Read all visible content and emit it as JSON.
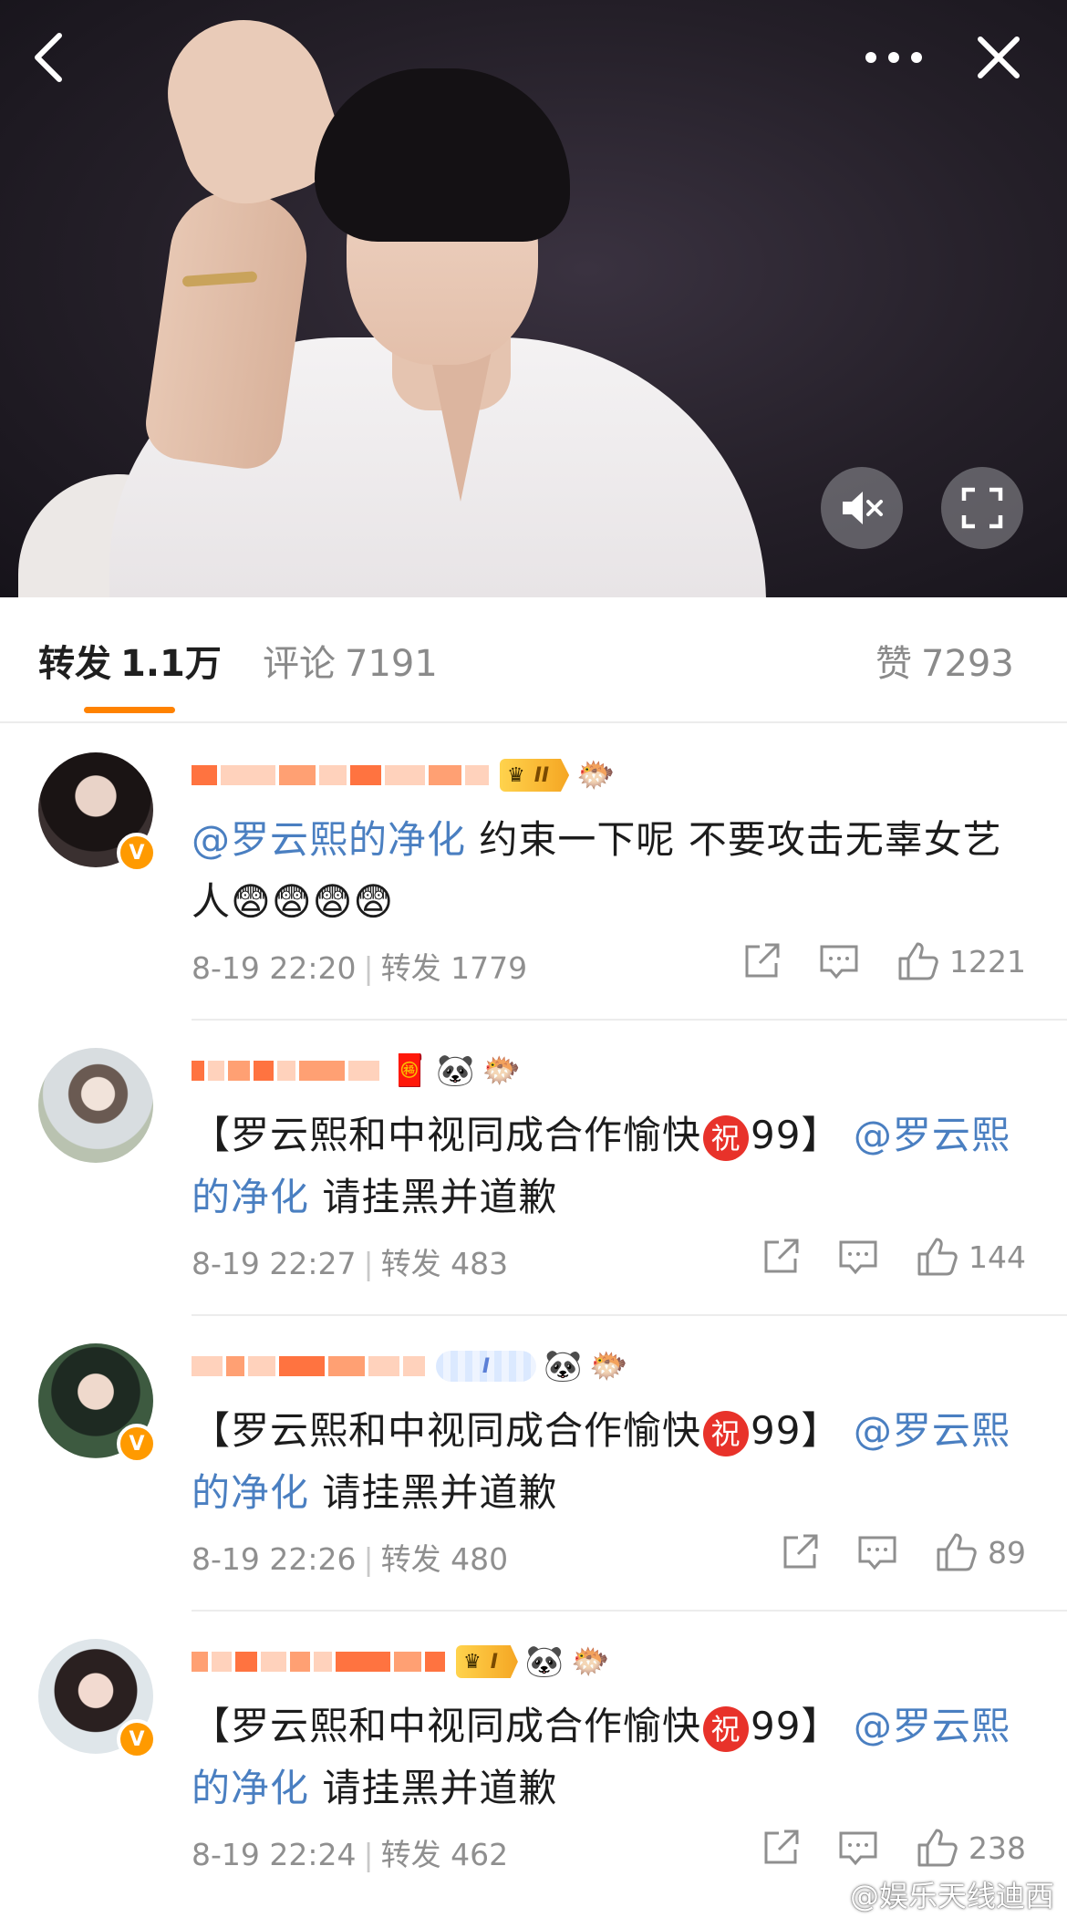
{
  "video": {
    "controls": [
      "back-icon",
      "more-icon",
      "close-icon",
      "mute-icon",
      "fullscreen-icon"
    ]
  },
  "tabs": {
    "repost": {
      "label": "转发",
      "count": "1.1万"
    },
    "comment": {
      "label": "评论",
      "count": "7191"
    },
    "like": {
      "label": "赞",
      "count": "7293"
    },
    "active": "repost"
  },
  "comments": [
    {
      "text_before": "",
      "mention": "@罗云熙的净化",
      "text_after": " 约束一下呢  不要攻击无辜女艺人",
      "emojis": [
        "😨",
        "😨",
        "😨",
        "😨"
      ],
      "date": "8-19 22:20",
      "repost_label": "转发",
      "repost_count": "1779",
      "likes": "1221",
      "badges": [
        "crown-II",
        "fish"
      ]
    },
    {
      "text_before": "【罗云熙和中视同成合作愉快",
      "zhu": "祝",
      "text_mid": "99】",
      "mention": "@罗云熙的净化",
      "text_after": " 请挂黑并道歉",
      "date": "8-19 22:27",
      "repost_label": "转发",
      "repost_count": "483",
      "likes": "144",
      "badges": [
        "gift",
        "panda",
        "fish"
      ]
    },
    {
      "text_before": "【罗云熙和中视同成合作愉快",
      "zhu": "祝",
      "text_mid": "99】",
      "mention": "@罗云熙的净化",
      "text_after": " 请挂黑并道歉",
      "date": "8-19 22:26",
      "repost_label": "转发",
      "repost_count": "480",
      "likes": "89",
      "badges": [
        "blue-I",
        "panda",
        "fish"
      ]
    },
    {
      "text_before": "【罗云熙和中视同成合作愉快",
      "zhu": "祝",
      "text_mid": "99】",
      "mention": "@罗云熙的净化",
      "text_after": " 请挂黑并道歉",
      "date": "8-19 22:24",
      "repost_label": "转发",
      "repost_count": "462",
      "likes": "238",
      "badges": [
        "crown-I",
        "panda",
        "fish"
      ]
    }
  ],
  "badge_text": {
    "crown_II": "II",
    "crown_I": "I",
    "blue_I": "I",
    "v": "V"
  },
  "watermark": "@娱乐天线迪西",
  "colors": {
    "accent": "#ff8200",
    "mention": "#4a7fc1",
    "meta": "#8f8f8f"
  }
}
